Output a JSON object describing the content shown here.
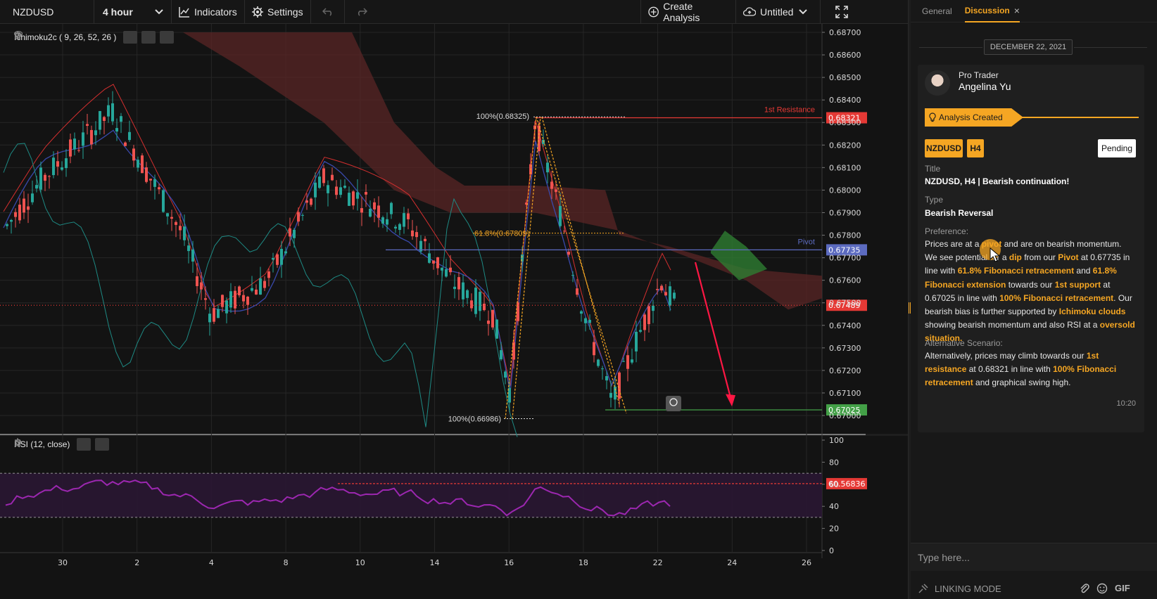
{
  "toolbar": {
    "symbol": "NZDUSD",
    "timeframe": "4 hour",
    "indicators_label": "Indicators",
    "settings_label": "Settings",
    "create_analysis_label": "Create Analysis",
    "layout_label": "Untitled"
  },
  "main_panel": {
    "indicator_label": "Ichimoku2c ( 9, 26, 52, 26 )",
    "price_ticks": [
      "0.68700",
      "0.68600",
      "0.68500",
      "0.68400",
      "0.68300",
      "0.68200",
      "0.68100",
      "0.68000",
      "0.67900",
      "0.67800",
      "0.67700",
      "0.67600",
      "0.67500",
      "0.67400",
      "0.67300",
      "0.67200",
      "0.67100",
      "0.67000"
    ],
    "resistance_label": "1st Resistance",
    "resistance_price": "0.68321",
    "pivot_label": "Pivot",
    "pivot_price": "0.67735",
    "current_price": "0.67489",
    "support_price": "0.67025",
    "fib_top_label": "100%(0.68325)",
    "fib_mid_label": "61.8%(0.67809)",
    "fib_bottom_label": "100%(0.66986)",
    "colors": {
      "resistance": "#e53935",
      "pivot": "#5c6bc0",
      "support": "#43a047",
      "current": "#e53935",
      "fib": "#f5a623",
      "bull": "#26a69a",
      "bear": "#ef5350"
    }
  },
  "rsi_panel": {
    "label": "RSI (12, close)",
    "ticks": [
      "100",
      "80",
      "60",
      "40",
      "20",
      "0"
    ],
    "current_value": "60.56836"
  },
  "x_axis": {
    "labels": [
      "30",
      "2",
      "4",
      "8",
      "10",
      "14",
      "16",
      "18",
      "22",
      "24",
      "26"
    ]
  },
  "sidebar": {
    "tabs": [
      {
        "label": "General"
      },
      {
        "label": "Discussion"
      }
    ],
    "close_glyph": "×",
    "date": "DECEMBER 22, 2021",
    "author_role": "Pro Trader",
    "author_name": "Angelina Yu",
    "status_tag": "Analysis Created",
    "symbol_badge": "NZDUSD",
    "timeframe_badge": "H4",
    "pending_label": "Pending",
    "title_label": "Title",
    "title_value": "NZDUSD, H4 | Bearish continuation!",
    "type_label": "Type",
    "type_value": "Bearish Reversal",
    "preference_label": "Preference:",
    "preference": {
      "t1": "Prices are at a ",
      "h1": "pivot",
      "t2": " and are on bearish momentum. We see potential for a ",
      "h2": "dip",
      "t3": " from our ",
      "h3": "Pivot",
      "t4": " at 0.67735 in line with ",
      "h4": "61.8% Fibonacci retracement",
      "t5": " and ",
      "h5": "61.8% Fibonacci extension",
      "t6": " towards our ",
      "h6": "1st support",
      "t7": " at 0.67025 in line with ",
      "h7": "100% Fibonacci retracement",
      "t8": ". Our bearish bias is further supported by ",
      "h8": "Ichimoku clouds",
      "t9": " showing bearish momentum and also RSI at a ",
      "h9": "oversold situation."
    },
    "alt_label": "Alternative Scenario:",
    "alt": {
      "t1": "Alternatively, prices may climb towards our ",
      "h1": "1st resistance",
      "t2": " at 0.68321 in line with ",
      "h2": "100% Fibonacci retracement",
      "t3": " and graphical swing high."
    },
    "time": "10:20",
    "input_placeholder": "Type here...",
    "linking_mode": "LINKING MODE",
    "gif_label": "GIF"
  }
}
